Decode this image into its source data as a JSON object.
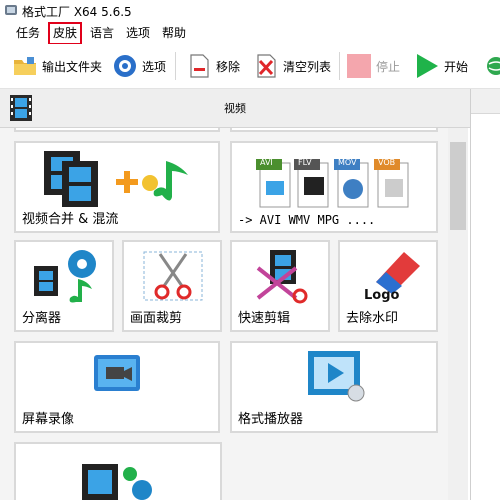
{
  "window": {
    "title": "格式工厂 X64 5.6.5"
  },
  "menu": {
    "items": [
      "任务",
      "皮肤",
      "语言",
      "选项",
      "帮助"
    ],
    "selected": "皮肤"
  },
  "toolbar": {
    "output_folder": "输出文件夹",
    "options": "选项",
    "remove": "移除",
    "clear_list": "清空列表",
    "stop": "停止",
    "start": "开始"
  },
  "section": {
    "title": "视频"
  },
  "tiles": {
    "merge_mix": "视频合并 & 混流",
    "formats": "-> AVI WMV MPG ....",
    "format_badges": [
      "AVI",
      "FLV",
      "MOV",
      "VOB"
    ],
    "separator": "分离器",
    "crop": "画面裁剪",
    "quick_clip": "快速剪辑",
    "remove_watermark": "去除水印",
    "logo_text": "Logo",
    "screen_record": "屏幕录像",
    "player": "格式播放器"
  },
  "colors": {
    "accent_green": "#1fb34a",
    "selection_red": "#e0001a",
    "stop_pink": "#f4a6ad"
  }
}
